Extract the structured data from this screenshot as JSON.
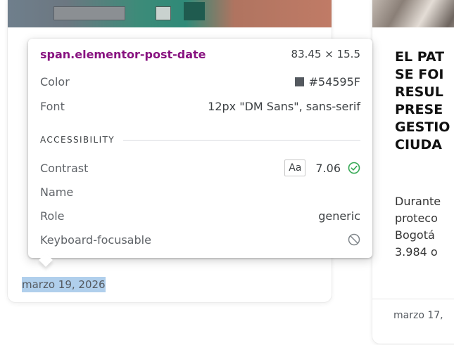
{
  "left_card": {
    "post_date": "marzo 19, 2026"
  },
  "right_card": {
    "title_lines": [
      "EL PAT",
      "SE FOI",
      "RESUL",
      "PRESE",
      "GESTIO",
      "CIUDA"
    ],
    "excerpt_lines": [
      "Durante",
      "proteco",
      "Bogotá",
      "3.984 o"
    ],
    "post_date": "marzo 17,"
  },
  "inspector": {
    "selector": "span.elementor-post-date",
    "size": "83.45 × 15.5",
    "color_label": "Color",
    "color_value": "#54595F",
    "font_label": "Font",
    "font_value": "12px \"DM Sans\", sans-serif",
    "section_title": "ACCESSIBILITY",
    "contrast_label": "Contrast",
    "contrast_badge": "Aa",
    "contrast_value": "7.06",
    "name_label": "Name",
    "role_label": "Role",
    "role_value": "generic",
    "keyboard_label": "Keyboard-focusable"
  },
  "colors": {
    "text_color_swatch": "#54595F",
    "selector_color": "#881280",
    "ok_green": "#34a853",
    "highlight": "#6fa8dc"
  },
  "icons": {
    "contrast_ok": "check-circle-icon",
    "keyboard_not_focusable": "prohibited-icon"
  }
}
